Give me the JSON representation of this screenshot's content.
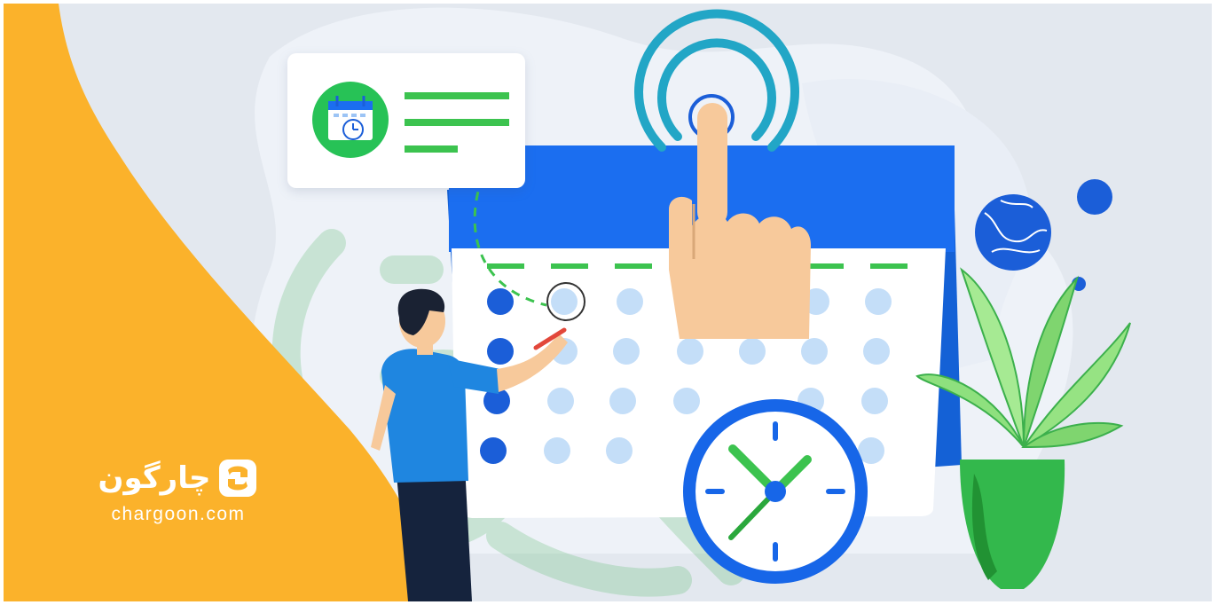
{
  "brand": {
    "name": "چارگون",
    "domain": "chargoon.com",
    "logo_icon": "chargoon-logo-icon"
  },
  "colors": {
    "background": "#e3e8ef",
    "accent_orange": "#fbb22b",
    "calendar_blue": "#1766e8",
    "dot_light": "#c4def8",
    "dot_dark": "#1b5ed8",
    "green": "#3cc34f",
    "skin": "#f7c99b",
    "shirt": "#1f86e0"
  }
}
